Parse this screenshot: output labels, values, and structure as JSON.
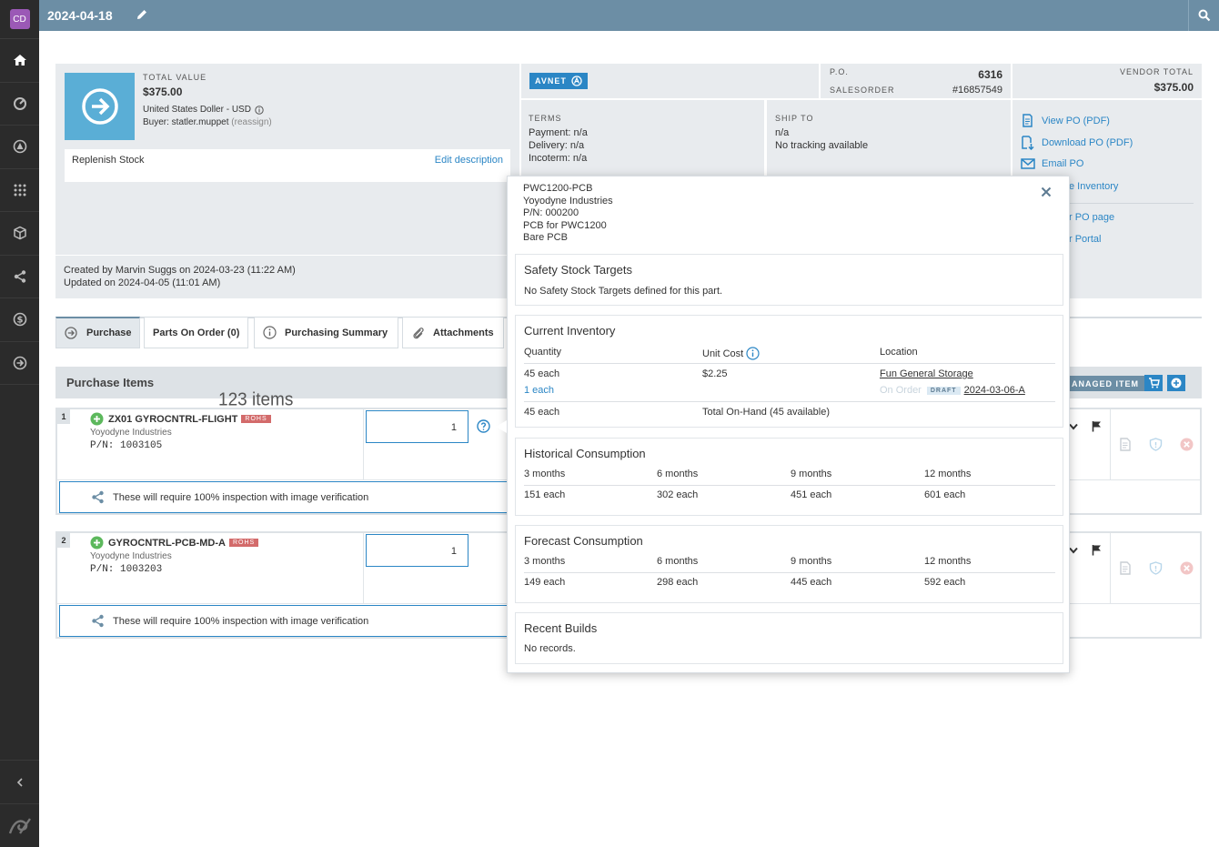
{
  "sidebar": {
    "logo_text": "CD",
    "items": [
      "home-icon",
      "gauge-icon",
      "triangle-icon",
      "grid-icon",
      "cube-icon",
      "share-icon",
      "dollar-icon",
      "arrow-right-circle-icon"
    ]
  },
  "topbar": {
    "title": "2024-04-18"
  },
  "summary": {
    "total_value_label": "TOTAL VALUE",
    "total_value": "$375.00",
    "currency": "United States Doller - USD",
    "buyer_prefix": "Buyer: statler.muppet",
    "reassign": "(reassign)",
    "description": "Replenish Stock",
    "edit_description": "Edit description",
    "created": "Created by Marvin Suggs on 2024-03-23 (11:22 AM)",
    "updated": "Updated on 2024-04-05 (11:01 AM)"
  },
  "vendor": {
    "name": "AVNET"
  },
  "po": {
    "po_label": "P.O.",
    "po_value": "6316",
    "so_label": "SALESORDER",
    "so_value": "#16857549"
  },
  "vendor_total": {
    "label": "VENDOR TOTAL",
    "value": "$375.00"
  },
  "terms": {
    "label": "TERMS",
    "payment": "Payment: n/a",
    "delivery": "Delivery: n/a",
    "incoterm": "Incoterm: n/a"
  },
  "ship_to": {
    "label": "SHIP TO",
    "value": "n/a",
    "tracking": "No tracking available"
  },
  "actions": {
    "view_po": "View PO (PDF)",
    "download_po": "Download PO (PDF)",
    "email_po": "Email PO",
    "inventory": "e Inventory",
    "po_page": "r PO page",
    "portal": "r Portal"
  },
  "tabs": {
    "purchase": "Purchase",
    "parts_on_order": "Parts On Order (0)",
    "purchasing_summary": "Purchasing Summary",
    "attachments": "Attachments"
  },
  "purchase_items": {
    "heading": "Purchase Items",
    "count": "123 items",
    "managed_item": "ANAGED ITEM",
    "rows": [
      {
        "num": "1",
        "name": "ZX01 GYROCNTRL-FLIGHT",
        "badge": "ROHS",
        "vendor": "Yoyodyne Industries",
        "pn": "P/N: 1003105",
        "qty": "1",
        "note": "These will require 100% inspection with image verification"
      },
      {
        "num": "2",
        "name": "GYROCNTRL-PCB-MD-A",
        "badge": "ROHS",
        "vendor": "Yoyodyne Industries",
        "pn": "P/N: 1003203",
        "qty": "1",
        "note": "These will require 100% inspection with image verification"
      }
    ]
  },
  "popover": {
    "part": "PWC1200-PCB",
    "vendor": "Yoyodyne Industries",
    "pn": "P/N: 000200",
    "desc1": "PCB for PWC1200",
    "desc2": "Bare PCB",
    "safety": {
      "title": "Safety Stock Targets",
      "text": "No Safety Stock Targets defined for this part."
    },
    "inventory": {
      "title": "Current Inventory",
      "col_qty": "Quantity",
      "col_cost": "Unit Cost",
      "col_loc": "Location",
      "qty": "45 each",
      "cost": "$2.25",
      "loc": "Fun General Storage",
      "order_qty": "1 each",
      "on_order": "On Order",
      "draft": "DRAFT",
      "order_ref": "2024-03-06-A",
      "total_qty": "45 each",
      "total_text": "Total On-Hand (45 available)"
    },
    "historical": {
      "title": "Historical Consumption",
      "headers": [
        "3 months",
        "6 months",
        "9 months",
        "12 months"
      ],
      "values": [
        "151 each",
        "302 each",
        "451 each",
        "601 each"
      ]
    },
    "forecast": {
      "title": "Forecast Consumption",
      "headers": [
        "3 months",
        "6 months",
        "9 months",
        "12 months"
      ],
      "values": [
        "149 each",
        "298 each",
        "445 each",
        "592 each"
      ]
    },
    "builds": {
      "title": "Recent Builds",
      "text": "No records."
    }
  }
}
